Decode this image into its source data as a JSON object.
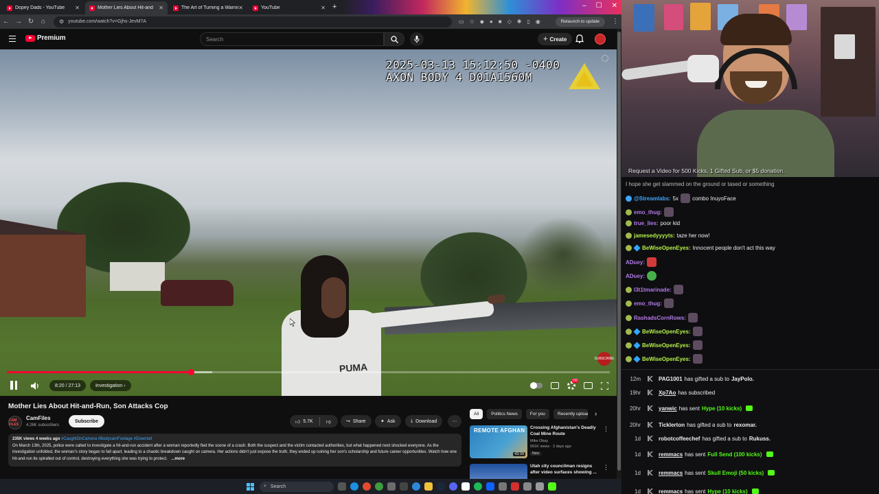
{
  "browser": {
    "tabs": [
      {
        "label": "Dopey Dads - YouTube",
        "active": false
      },
      {
        "label": "Mother Lies About Hit-and",
        "active": true
      },
      {
        "label": "The Art of Turning a Warning in",
        "active": false
      },
      {
        "label": "YouTube",
        "active": false
      }
    ],
    "url": "youtube.com/watch?v=Gjhs-JevM7A",
    "relaunch_label": "Relaunch to update"
  },
  "youtube": {
    "logo_text": "Premium",
    "search_placeholder": "Search",
    "create_label": "Create"
  },
  "video": {
    "timestamp_line1": "2025-03-13 15:12:50 -0400",
    "timestamp_line2": "AXON BODY 4 D01A1560M",
    "shirt_text": "PUMA",
    "time": "8:20 / 27:13",
    "chapter": "Investigation",
    "progress": 0.306,
    "buffered": 0.34,
    "watermark": "SUBSCRIBE",
    "title": "Mother Lies About Hit-and-Run, Son Attacks Cop"
  },
  "channel": {
    "avatar_text": "CAM FILES",
    "name": "CamFiles",
    "subs": "4.26K subscribers",
    "subscribe_label": "Subscribe"
  },
  "actions": {
    "likes": "5.7K",
    "share": "Share",
    "ask": "Ask",
    "download": "Download"
  },
  "description": {
    "meta": "235K views  4 weeks ago",
    "tags": "#CaughtOnCamera #BodycamFootage #Downfall",
    "text": "On March 13th, 2025, police were called to investigate a hit-and-run accident after a woman reportedly fled the scene of a crash. Both the suspect and the victim contacted authorities, but what happened next shocked everyone. As the investigation unfolded, the woman's story began to fall apart, leading to a chaotic breakdown caught on camera. Her actions didn't just expose the truth, they ended up ruining her son's scholarship and future career opportunities. Watch how one hit-and-run lie spiralled out of control, destroying everything she was trying to protect.",
    "more": "...more"
  },
  "chips": [
    "All",
    "Politics News",
    "For you",
    "Recently uploaded"
  ],
  "recommendations": [
    {
      "thumb_text": "REMOTE AFGHAN",
      "title": "Crossing Afghanistan's Deadly Coal Mine Route",
      "channel": "Mike Okay",
      "views": "691K views · 2 days ago",
      "badge": "New",
      "duration": "43:39"
    },
    {
      "thumb_text": "",
      "title": "Utah city councilman resigns after video surfaces showing ...",
      "channel": "",
      "views": "",
      "badge": "",
      "duration": ""
    }
  ],
  "taskbar": {
    "search": "Search"
  },
  "stream": {
    "overlay": "Request a Video for 500 Kicks, 1 Gifted Sub, or $5 donation.",
    "chat_cut": "I hope she get slammed on the ground or tased or something",
    "chat": [
      {
        "user": "@Streamlabs:",
        "text": "5x",
        "extra": "combo InuyoFace",
        "color": "#3ea6ff",
        "badge": "bot",
        "emote": "default"
      },
      {
        "user": "emo_thug:",
        "text": "",
        "color": "#b37ae8",
        "badge": "sub",
        "emote": "default"
      },
      {
        "user": "true_lies:",
        "text": "poor kid",
        "color": "#b37ae8",
        "badge": "sub",
        "emote": ""
      },
      {
        "user": "jamesedyyyyts:",
        "text": "taze her now!",
        "color": "#b5f04a",
        "badge": "sub",
        "emote": ""
      },
      {
        "user": "BeWiseOpenEyes:",
        "text": "Innocent people don't act this way",
        "color": "#b5f04a",
        "badge": "both",
        "emote": ""
      },
      {
        "user": "ADuey:",
        "text": "",
        "color": "#b37ae8",
        "badge": "",
        "emote": "red"
      },
      {
        "user": "ADuey:",
        "text": "",
        "color": "#b37ae8",
        "badge": "",
        "emote": "green"
      },
      {
        "user": "l3t1tmarinade:",
        "text": "",
        "color": "#b37ae8",
        "badge": "sub",
        "emote": "default"
      },
      {
        "user": "emo_thug:",
        "text": "",
        "color": "#b37ae8",
        "badge": "sub",
        "emote": "default"
      },
      {
        "user": "RashadsCornRows:",
        "text": "",
        "color": "#b37ae8",
        "badge": "sub",
        "emote": "default"
      },
      {
        "user": "BeWiseOpenEyes:",
        "text": "",
        "color": "#b5f04a",
        "badge": "both",
        "emote": "default"
      },
      {
        "user": "BeWiseOpenEyes:",
        "text": "",
        "color": "#b5f04a",
        "badge": "both",
        "emote": "default"
      },
      {
        "user": "BeWiseOpenEyes:",
        "text": "",
        "color": "#b5f04a",
        "badge": "both",
        "emote": "default"
      }
    ],
    "events": [
      {
        "time": "12m",
        "name": "PAG1001",
        "action": "has gifted a sub to",
        "target": "JayPolo.",
        "amount": "",
        "underline": false
      },
      {
        "time": "19hr",
        "name": "Xp7Ao",
        "action": "has subscribed",
        "target": "",
        "amount": "",
        "underline": true
      },
      {
        "time": "20hr",
        "name": "yanwic",
        "action": "has sent",
        "target": "",
        "amount": "Hype (10 kicks)",
        "underline": true
      },
      {
        "time": "20hr",
        "name": "Ticklerton",
        "action": "has gifted a sub to",
        "target": "rexomar.",
        "amount": "",
        "underline": false
      },
      {
        "time": "1d",
        "name": "robotcoffeechef",
        "action": "has gifted a sub to",
        "target": "Rukuss.",
        "amount": "",
        "underline": false
      },
      {
        "time": "1d",
        "name": "remmacs",
        "action": "has sent",
        "target": "",
        "amount": "Full Send (100 kicks)",
        "underline": true
      },
      {
        "time": "1d",
        "name": "remmacs",
        "action": "has sent",
        "target": "",
        "amount": "Skull Emoji (50 kicks)",
        "underline": true
      },
      {
        "time": "1d",
        "name": "remmacs",
        "action": "has sent",
        "target": "",
        "amount": "Hype (10 kicks)",
        "underline": true
      }
    ]
  },
  "colors": {
    "accent": "#ff0033",
    "kick": "#53fc18",
    "link": "#3ea6ff"
  }
}
